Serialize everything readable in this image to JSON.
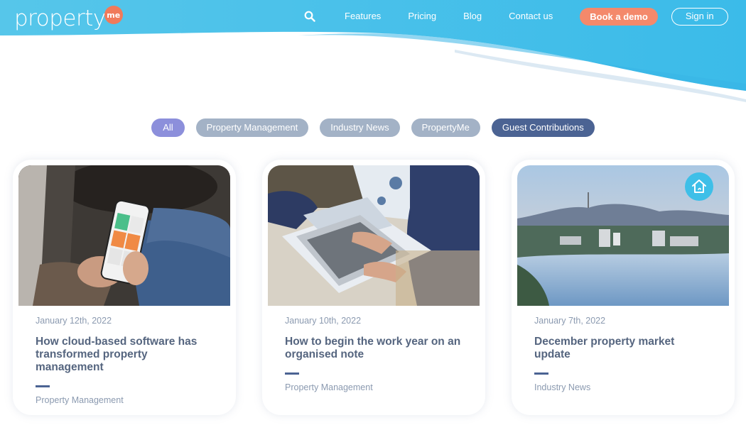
{
  "header": {
    "logo_text": "property",
    "logo_badge": "me",
    "nav": [
      {
        "label": "Features"
      },
      {
        "label": "Pricing"
      },
      {
        "label": "Blog"
      },
      {
        "label": "Contact us"
      }
    ],
    "book_demo_label": "Book a demo",
    "sign_in_label": "Sign in",
    "search_icon": "search-icon"
  },
  "filters": [
    {
      "label": "All"
    },
    {
      "label": "Property Management"
    },
    {
      "label": "Industry News"
    },
    {
      "label": "PropertyMe"
    },
    {
      "label": "Guest Contributions"
    }
  ],
  "posts": [
    {
      "date": "January 12th, 2022",
      "title": "How cloud-based software has transformed property management",
      "category": "Property Management"
    },
    {
      "date": "January 10th, 2022",
      "title": "How to begin the work year on an organised note",
      "category": "Property Management"
    },
    {
      "date": "January 7th, 2022",
      "title": "December property market update",
      "category": "Industry News"
    }
  ],
  "colors": {
    "header_gradient_start": "#4fc3ea",
    "header_gradient_end": "#3fb8e8",
    "accent_orange": "#f4896b",
    "filter_all": "#8c8fdb",
    "filter_default": "#a3b2c6",
    "filter_guest": "#4b6393"
  }
}
